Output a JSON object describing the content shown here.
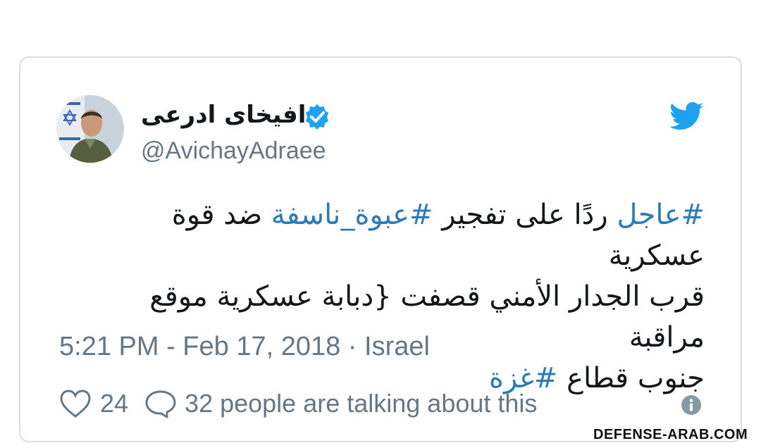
{
  "tweet": {
    "author": {
      "display_name": "افيخاى ادرعى",
      "handle": "@AvichayAdraee",
      "verified": true
    },
    "text": {
      "line1": {
        "hashtag1": "#عاجل",
        "plain1": " ردًا على تفجير ",
        "hashtag2": "#عبوة_ناسفة",
        "plain2": " ضد قوة عسكرية"
      },
      "line2": "قرب الجدار الأمني قصفت {دبابة عسكرية موقع مراقبة",
      "line3": {
        "plain": "جنوب قطاع ",
        "hashtag": "#غزة"
      }
    },
    "timestamp": "5:21 PM - Feb 17, 2018 · Israel",
    "likes": "24",
    "talking": "32 people are talking about this"
  },
  "icons": {
    "bird": "twitter-bird-icon",
    "verified": "verified-badge-icon",
    "heart": "heart-icon",
    "bubble": "chat-bubble-icon",
    "info": "info-icon"
  },
  "colors": {
    "twitter_blue": "#1da1f2",
    "hashtag": "#2b7bb9",
    "secondary_text": "#657786"
  },
  "watermark": "DEFENSE-ARAB.COM"
}
